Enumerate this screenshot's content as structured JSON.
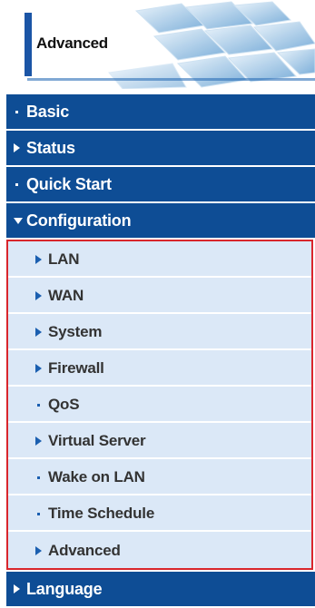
{
  "header": {
    "title": "Advanced"
  },
  "menu": [
    {
      "label": "Basic",
      "marker": "dot"
    },
    {
      "label": "Status",
      "marker": "arrow-right"
    },
    {
      "label": "Quick Start",
      "marker": "dot"
    },
    {
      "label": "Configuration",
      "marker": "arrow-down",
      "expanded": true,
      "children": [
        {
          "label": "LAN",
          "marker": "arrow-right"
        },
        {
          "label": "WAN",
          "marker": "arrow-right"
        },
        {
          "label": "System",
          "marker": "arrow-right"
        },
        {
          "label": "Firewall",
          "marker": "arrow-right"
        },
        {
          "label": "QoS",
          "marker": "dot"
        },
        {
          "label": "Virtual Server",
          "marker": "arrow-right"
        },
        {
          "label": "Wake on LAN",
          "marker": "dot"
        },
        {
          "label": "Time Schedule",
          "marker": "dot"
        },
        {
          "label": "Advanced",
          "marker": "arrow-right"
        }
      ]
    },
    {
      "label": "Language",
      "marker": "arrow-right"
    }
  ],
  "colors": {
    "nav_bg": "#0e4d95",
    "sub_bg": "#dbe8f7",
    "highlight_border": "#d9262c",
    "sub_marker": "#1b5fb0"
  }
}
